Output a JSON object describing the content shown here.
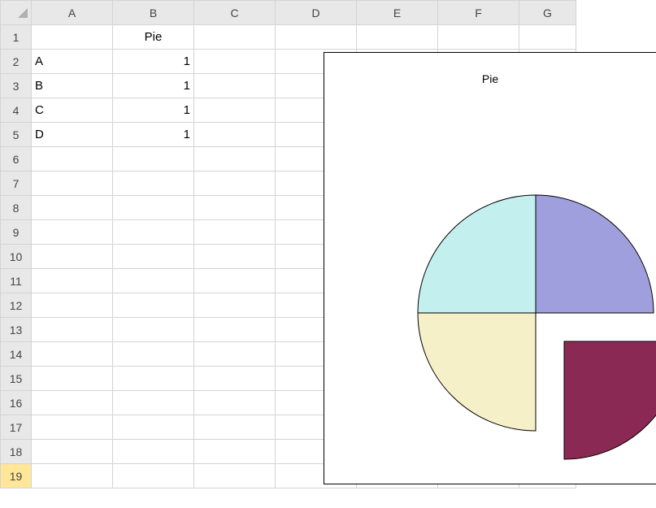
{
  "columns": [
    "A",
    "B",
    "C",
    "D",
    "E",
    "F",
    "G"
  ],
  "rows": [
    1,
    2,
    3,
    4,
    5,
    6,
    7,
    8,
    9,
    10,
    11,
    12,
    13,
    14,
    15,
    16,
    17,
    18,
    19
  ],
  "selected_row": 19,
  "cells": {
    "B1": "Pie",
    "A2": "A",
    "B2": "1",
    "A3": "B",
    "B3": "1",
    "A4": "C",
    "B4": "1",
    "A5": "D",
    "B5": "1"
  },
  "chart_data": {
    "type": "pie",
    "title": "Pie",
    "categories": [
      "A",
      "B",
      "C",
      "D"
    ],
    "values": [
      1,
      1,
      1,
      1
    ],
    "series": [
      {
        "name": "Pie",
        "values": [
          1,
          1,
          1,
          1
        ]
      }
    ],
    "colors": {
      "A": "#9f9fde",
      "B": "#8a2a54",
      "C": "#f5f0c8",
      "D": "#c3efef"
    },
    "exploded_slice": "B"
  }
}
